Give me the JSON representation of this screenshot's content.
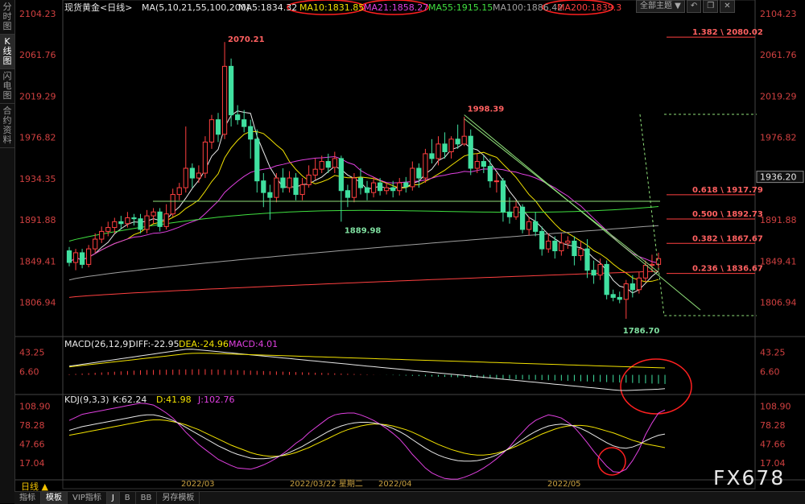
{
  "sidebar": {
    "tabs": [
      "分时图",
      "K线图",
      "闪电图",
      "合约资料"
    ],
    "active": 1
  },
  "toolbar": {
    "theme_label": "全部主题 ▼",
    "icons": [
      "undo-icon",
      "restore-icon",
      "close-icon"
    ]
  },
  "legend": {
    "instrument": "现货黄金<日线>",
    "ma_params": "MA(5,10,21,55,100,200)",
    "ma_items": [
      {
        "label": "MA5:1834.32",
        "color": "#e8e8e8"
      },
      {
        "label": "MA10:1831.85",
        "color": "#f2e200"
      },
      {
        "label": "MA21:1858.27",
        "color": "#e040e0"
      },
      {
        "label": "MA55:1915.15",
        "color": "#40e040"
      },
      {
        "label": "MA100:1886.42",
        "color": "#a0a0a0"
      },
      {
        "label": "MA200:1839.3",
        "color": "#ff4040"
      }
    ]
  },
  "macd_legend": {
    "params": "MACD(26,12,9)",
    "diff": "DIFF:-22.95",
    "dea": "DEA:-24.96",
    "macd": "MACD:4.01"
  },
  "kdj_legend": {
    "params": "KDJ(9,3,3)",
    "k": "K:62.24",
    "d": "D:41.98",
    "j": "J:102.76"
  },
  "bottom_tabs": [
    "指标",
    "模板",
    "VIP指标",
    "J",
    "B",
    "BB",
    "另存模板"
  ],
  "period_button": "日线 ▲",
  "watermark": "FX678",
  "chart_data": [
    {
      "type": "candlestick",
      "title": "现货黄金<日线>",
      "ylim": [
        1780,
        2110
      ],
      "y_ticks": [
        "2104.23",
        "2061.76",
        "2019.29",
        "1976.82",
        "1934.35",
        "1891.88",
        "1849.41",
        "1806.94"
      ],
      "x_tick_labels": [
        "2022/03",
        "2022/04",
        "2022/05"
      ],
      "crosshair_date": "2022/03/22 星期二",
      "last_price": "1936.20",
      "annotations": [
        "2070.21",
        "1998.39",
        "1889.98",
        "1786.70"
      ],
      "fibonacci": [
        {
          "label": "1.382 \\ 2080.02",
          "value": 2080.02
        },
        {
          "label": "0.618 \\ 1917.79",
          "value": 1917.79
        },
        {
          "label": "0.500 \\ 1892.73",
          "value": 1892.73
        },
        {
          "label": "0.382 \\ 1867.67",
          "value": 1867.67
        },
        {
          "label": "0.236 \\ 1836.67",
          "value": 1836.67
        }
      ],
      "horizontal_level": 1911,
      "ma_colors": {
        "MA5": "#e8e8e8",
        "MA10": "#f2e200",
        "MA21": "#e040e0",
        "MA55": "#40e040",
        "MA100": "#a0a0a0",
        "MA200": "#ff4040"
      },
      "candles": [
        [
          1860,
          1848,
          1864,
          1844
        ],
        [
          1848,
          1858,
          1862,
          1840
        ],
        [
          1858,
          1846,
          1862,
          1842
        ],
        [
          1846,
          1862,
          1866,
          1843
        ],
        [
          1862,
          1872,
          1878,
          1858
        ],
        [
          1872,
          1880,
          1885,
          1868
        ],
        [
          1880,
          1884,
          1890,
          1875
        ],
        [
          1884,
          1890,
          1894,
          1878
        ],
        [
          1890,
          1888,
          1896,
          1882
        ],
        [
          1888,
          1894,
          1900,
          1884
        ],
        [
          1894,
          1893,
          1898,
          1886
        ],
        [
          1893,
          1882,
          1898,
          1878
        ],
        [
          1882,
          1896,
          1902,
          1878
        ],
        [
          1896,
          1900,
          1904,
          1888
        ],
        [
          1900,
          1885,
          1904,
          1880
        ],
        [
          1885,
          1898,
          1908,
          1882
        ],
        [
          1898,
          1918,
          1924,
          1895
        ],
        [
          1918,
          1925,
          1930,
          1912
        ],
        [
          1925,
          1945,
          1988,
          1920
        ],
        [
          1945,
          1935,
          1950,
          1925
        ],
        [
          1935,
          1940,
          1948,
          1930
        ],
        [
          1940,
          1972,
          1978,
          1935
        ],
        [
          1972,
          1995,
          2000,
          1965
        ],
        [
          1995,
          1980,
          2002,
          1972
        ],
        [
          1980,
          2050,
          2075,
          1975
        ],
        [
          2050,
          2000,
          2058,
          1988
        ],
        [
          2000,
          1995,
          2010,
          1990
        ],
        [
          1995,
          1988,
          2005,
          1982
        ],
        [
          1988,
          1975,
          1995,
          1955
        ],
        [
          1975,
          1932,
          1985,
          1920
        ],
        [
          1932,
          1920,
          1940,
          1905
        ],
        [
          1920,
          1915,
          1928,
          1892
        ],
        [
          1915,
          1935,
          1940,
          1910
        ],
        [
          1935,
          1925,
          1945,
          1920
        ],
        [
          1925,
          1935,
          1942,
          1920
        ],
        [
          1935,
          1918,
          1940,
          1912
        ],
        [
          1918,
          1928,
          1935,
          1912
        ],
        [
          1928,
          1938,
          1948,
          1925
        ],
        [
          1938,
          1944,
          1955,
          1933
        ],
        [
          1944,
          1952,
          1958,
          1940
        ],
        [
          1952,
          1946,
          1960,
          1940
        ],
        [
          1946,
          1955,
          1962,
          1940
        ],
        [
          1955,
          1922,
          1958,
          1890
        ],
        [
          1922,
          1915,
          1928,
          1905
        ],
        [
          1915,
          1935,
          1940,
          1910
        ],
        [
          1935,
          1925,
          1945,
          1918
        ],
        [
          1925,
          1920,
          1932,
          1912
        ],
        [
          1920,
          1930,
          1936,
          1915
        ],
        [
          1930,
          1922,
          1935,
          1917
        ],
        [
          1922,
          1925,
          1930,
          1918
        ],
        [
          1925,
          1922,
          1932,
          1915
        ],
        [
          1922,
          1930,
          1935,
          1917
        ],
        [
          1930,
          1926,
          1936,
          1920
        ],
        [
          1926,
          1945,
          1952,
          1922
        ],
        [
          1945,
          1935,
          1950,
          1925
        ],
        [
          1935,
          1960,
          1965,
          1930
        ],
        [
          1960,
          1955,
          1975,
          1950
        ],
        [
          1955,
          1970,
          1978,
          1948
        ],
        [
          1970,
          1962,
          1982,
          1955
        ],
        [
          1962,
          1975,
          1978,
          1955
        ],
        [
          1975,
          1970,
          1990,
          1965
        ],
        [
          1970,
          1978,
          1998,
          1968
        ],
        [
          1978,
          1945,
          1985,
          1938
        ],
        [
          1945,
          1952,
          1960,
          1940
        ],
        [
          1952,
          1947,
          1958,
          1940
        ],
        [
          1947,
          1932,
          1955,
          1925
        ],
        [
          1932,
          1932,
          1940,
          1920
        ],
        [
          1932,
          1900,
          1935,
          1890
        ],
        [
          1900,
          1895,
          1915,
          1888
        ],
        [
          1895,
          1905,
          1912,
          1892
        ],
        [
          1905,
          1882,
          1908,
          1878
        ],
        [
          1882,
          1890,
          1895,
          1876
        ],
        [
          1890,
          1880,
          1900,
          1875
        ],
        [
          1880,
          1862,
          1885,
          1855
        ],
        [
          1862,
          1870,
          1878,
          1858
        ],
        [
          1870,
          1860,
          1875,
          1852
        ],
        [
          1860,
          1868,
          1878,
          1855
        ],
        [
          1868,
          1870,
          1875,
          1862
        ],
        [
          1870,
          1855,
          1875,
          1845
        ],
        [
          1855,
          1862,
          1870,
          1850
        ],
        [
          1862,
          1840,
          1872,
          1832
        ],
        [
          1840,
          1835,
          1850,
          1826
        ],
        [
          1835,
          1846,
          1852,
          1830
        ],
        [
          1846,
          1815,
          1850,
          1810
        ],
        [
          1815,
          1812,
          1820,
          1808
        ],
        [
          1812,
          1810,
          1818,
          1806
        ],
        [
          1810,
          1826,
          1830,
          1790
        ],
        [
          1826,
          1820,
          1835,
          1812
        ],
        [
          1820,
          1832,
          1838,
          1816
        ],
        [
          1832,
          1845,
          1850,
          1828
        ],
        [
          1845,
          1846,
          1856,
          1838
        ],
        [
          1846,
          1852,
          1858,
          1842
        ]
      ]
    },
    {
      "type": "bar",
      "name": "MACD(26,12,9)",
      "ylim": [
        -30,
        55
      ],
      "y_ticks": [
        "43.25",
        "6.60"
      ],
      "diff_color": "#e8e8e8",
      "dea_color": "#f2e200",
      "diff_values": [
        16.6,
        18.4,
        20.2,
        22.0,
        23.8,
        25.6,
        27.4,
        29.2,
        31.0,
        32.8,
        34.6,
        36.4,
        38.2,
        40.0,
        41.8,
        43.6,
        45.4,
        47.2,
        49.0,
        49.3,
        48.1,
        46.9,
        45.7,
        44.5,
        43.3,
        42.1,
        40.9,
        39.7,
        38.5,
        37.3,
        36.1,
        34.9,
        33.7,
        32.5,
        31.3,
        30.1,
        28.9,
        27.7,
        26.5,
        25.3,
        24.1,
        22.9,
        21.7,
        20.5,
        19.3,
        18.1,
        16.9,
        15.7,
        14.5,
        13.3,
        12.1,
        10.9,
        9.7,
        8.5,
        7.3,
        6.1,
        4.9,
        3.7,
        2.5,
        1.3,
        0.1,
        -1.1,
        -2.3,
        -3.5,
        -4.7,
        -5.9,
        -7.1,
        -8.3,
        -9.5,
        -10.7,
        -11.9,
        -13.1,
        -14.3,
        -15.5,
        -16.7,
        -17.9,
        -19.1,
        -20.3,
        -21.5,
        -22.7,
        -23.9,
        -25.1,
        -26.3,
        -27.5,
        -28.7,
        -29.9,
        -30.0,
        -29.5,
        -29.0,
        -28.5,
        -28.0,
        -27.5,
        -26.4
      ],
      "dea_values": [
        15.2,
        16.6,
        18.0,
        19.4,
        20.8,
        22.2,
        23.6,
        25.0,
        26.4,
        27.8,
        29.2,
        30.6,
        32.0,
        33.4,
        34.8,
        36.2,
        37.6,
        39.0,
        40.4,
        41.2,
        41.4,
        41.6,
        41.2,
        40.8,
        40.4,
        40.0,
        39.6,
        39.2,
        38.8,
        38.4,
        38.0,
        37.6,
        37.2,
        36.8,
        36.4,
        36.0,
        35.6,
        35.2,
        34.8,
        34.4,
        34.0,
        33.6,
        33.2,
        32.8,
        32.4,
        32.0,
        31.6,
        31.2,
        30.8,
        30.4,
        30.0,
        29.6,
        29.2,
        28.8,
        28.4,
        28.0,
        27.6,
        27.2,
        26.8,
        26.4,
        26.0,
        25.6,
        25.2,
        24.8,
        24.4,
        24.0,
        23.6,
        23.2,
        22.8,
        22.4,
        22.0,
        21.6,
        21.2,
        20.8,
        20.4,
        20.0,
        19.6,
        19.2,
        18.8,
        18.4,
        18.0,
        17.6,
        17.2,
        16.8,
        16.4,
        16.0,
        15.6,
        15.2,
        14.8,
        14.4,
        14.0,
        13.6,
        13.2
      ],
      "hist_values": [
        2.2,
        3.6,
        5.0,
        6.4,
        7.8,
        9.2,
        10.6,
        12.0,
        13.4,
        14.8,
        16.2,
        17.6,
        18.6,
        19.0,
        19.4,
        19.8,
        20.2,
        20.6,
        21.0,
        21.4,
        21.8,
        21.8,
        21.0,
        20.2,
        19.4,
        18.6,
        17.8,
        17.0,
        16.2,
        15.4,
        14.6,
        13.8,
        13.0,
        12.2,
        11.4,
        10.6,
        9.8,
        9.0,
        8.2,
        7.4,
        6.6,
        5.8,
        5.0,
        4.2,
        3.4,
        2.6,
        1.8,
        1.0,
        0.2,
        -0.6,
        -1.4,
        -2.2,
        -3.0,
        -3.8,
        -4.6,
        -5.4,
        -6.2,
        -7.0,
        -7.8,
        -8.6,
        -9.4,
        -10.2,
        -11.0,
        -11.8,
        -12.6,
        -13.4,
        -14.2,
        -15.0,
        -15.8,
        -16.6,
        -17.4,
        -18.2,
        -19.0,
        -19.8,
        -20.6,
        -21.4,
        -22.2,
        -23.0,
        -23.8,
        -24.6,
        -25.4,
        -26.2,
        -27.0,
        -27.8,
        -28.6,
        -29.4,
        -30.2,
        -31.0,
        -31.8,
        -32.6,
        -33.4,
        -34.2,
        -35.0
      ]
    },
    {
      "type": "line",
      "name": "KDJ(9,3,3)",
      "ylim": [
        -5,
        115
      ],
      "y_ticks": [
        "108.90",
        "78.28",
        "47.66",
        "17.04"
      ],
      "k_color": "#e8e8e8",
      "d_color": "#f2e200",
      "j_color": "#e040e0",
      "k_values": [
        70,
        73,
        76,
        78,
        80,
        82,
        84,
        86,
        88,
        90,
        92,
        94,
        95,
        95,
        93,
        90,
        86,
        81,
        75,
        69,
        63,
        57,
        51,
        45,
        40,
        35,
        31,
        28,
        25,
        24,
        24,
        25,
        27,
        30,
        34,
        39,
        44,
        50,
        56,
        62,
        68,
        73,
        77,
        80,
        82,
        83,
        83,
        82,
        80,
        77,
        73,
        68,
        62,
        55,
        48,
        41,
        35,
        30,
        26,
        23,
        21,
        20,
        20,
        21,
        23,
        26,
        30,
        35,
        41,
        48,
        55,
        62,
        68,
        73,
        77,
        79,
        80,
        79,
        77,
        73,
        68,
        62,
        56,
        50,
        45,
        42,
        41,
        43,
        47,
        53,
        58,
        62,
        64
      ],
      "d_values": [
        62,
        64,
        66,
        68,
        70,
        72,
        74,
        76,
        78,
        80,
        82,
        84,
        86,
        87,
        87,
        86,
        84,
        82,
        79,
        75,
        71,
        66,
        61,
        56,
        51,
        46,
        42,
        38,
        34,
        31,
        29,
        28,
        28,
        29,
        31,
        34,
        38,
        42,
        47,
        52,
        57,
        62,
        67,
        71,
        74,
        77,
        79,
        80,
        80,
        79,
        77,
        74,
        71,
        67,
        62,
        57,
        52,
        47,
        43,
        39,
        36,
        33,
        31,
        30,
        30,
        31,
        33,
        36,
        40,
        44,
        49,
        54,
        59,
        64,
        68,
        72,
        75,
        77,
        78,
        78,
        77,
        75,
        72,
        69,
        66,
        62,
        58,
        54,
        51,
        48,
        46,
        44,
        42
      ],
      "j_values": [
        86,
        91,
        96,
        98,
        100,
        102,
        104,
        106,
        108,
        110,
        112,
        114,
        113,
        111,
        105,
        98,
        90,
        79,
        67,
        57,
        47,
        39,
        31,
        23,
        18,
        13,
        9,
        8,
        7,
        10,
        14,
        19,
        25,
        32,
        40,
        49,
        56,
        66,
        74,
        82,
        90,
        95,
        97,
        98,
        98,
        95,
        91,
        86,
        80,
        73,
        65,
        56,
        44,
        31,
        20,
        9,
        1,
        -4,
        -8,
        -9,
        -9,
        -6,
        -2,
        3,
        9,
        16,
        24,
        33,
        43,
        56,
        67,
        78,
        86,
        91,
        95,
        93,
        90,
        83,
        75,
        63,
        50,
        36,
        24,
        12,
        3,
        2,
        7,
        21,
        39,
        63,
        82,
        98,
        103
      ]
    }
  ]
}
